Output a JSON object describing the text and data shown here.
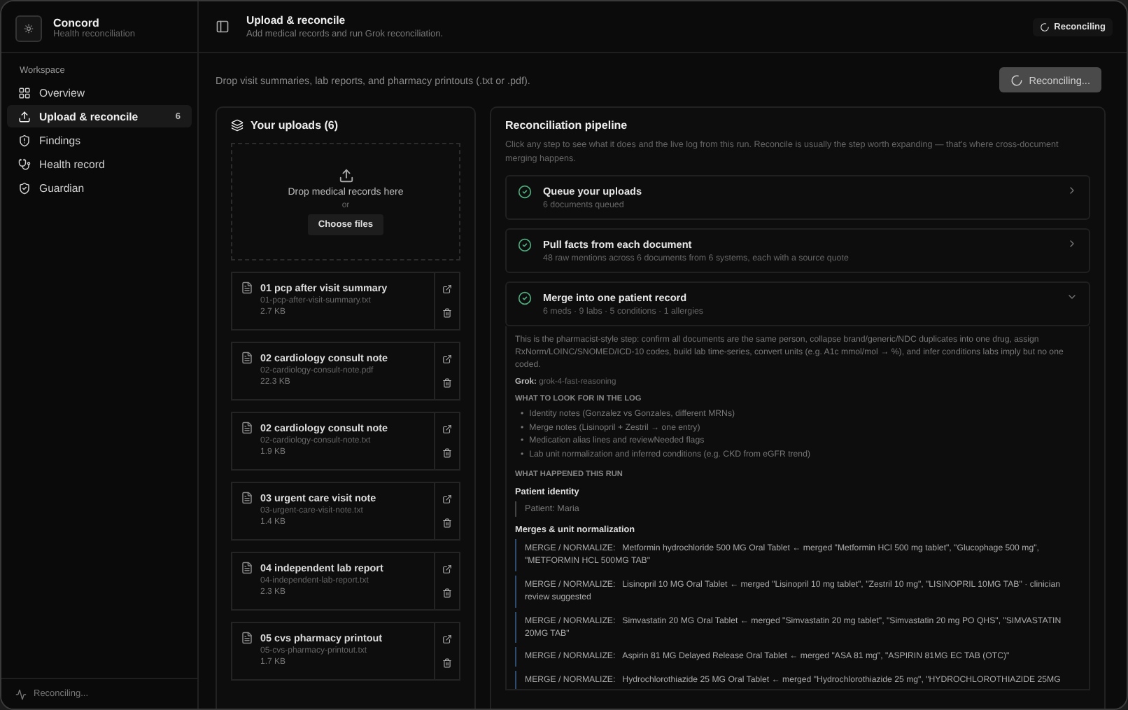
{
  "sidebar": {
    "app_name": "Concord",
    "app_subtitle": "Health reconciliation",
    "section": "Workspace",
    "items": [
      {
        "kind": "overview",
        "label": "Overview",
        "selected": false
      },
      {
        "kind": "upload",
        "label": "Upload & reconcile",
        "selected": true,
        "count": "6"
      },
      {
        "kind": "findings",
        "label": "Findings",
        "selected": false
      },
      {
        "kind": "health",
        "label": "Health record",
        "selected": false
      },
      {
        "kind": "guardian",
        "label": "Guardian",
        "selected": false
      }
    ],
    "footer_status": "Reconciling..."
  },
  "header": {
    "title": "Upload & reconcile",
    "subtitle": "Add medical records and run Grok reconciliation.",
    "status_badge": "Reconciling"
  },
  "intro": "Drop visit summaries, lab reports, and pharmacy printouts (.txt or .pdf).",
  "action_button": {
    "label": "Reconciling...",
    "disabled": true
  },
  "uploads": {
    "title": "Your uploads (6)",
    "dropzone": {
      "text": "Drop medical records here",
      "or": "or",
      "button": "Choose files"
    },
    "files": [
      {
        "name": "01 pcp after visit summary",
        "filename": "01-pcp-after-visit-summary.txt",
        "size": "2.7 KB"
      },
      {
        "name": "02 cardiology consult note",
        "filename": "02-cardiology-consult-note.pdf",
        "size": "22.3 KB"
      },
      {
        "name": "02 cardiology consult note",
        "filename": "02-cardiology-consult-note.txt",
        "size": "1.9 KB"
      },
      {
        "name": "03 urgent care visit note",
        "filename": "03-urgent-care-visit-note.txt",
        "size": "1.4 KB"
      },
      {
        "name": "04 independent lab report",
        "filename": "04-independent-lab-report.txt",
        "size": "2.3 KB"
      },
      {
        "name": "05 cvs pharmacy printout",
        "filename": "05-cvs-pharmacy-printout.txt",
        "size": "1.7 KB"
      }
    ]
  },
  "pipeline": {
    "title": "Reconciliation pipeline",
    "description": "Click any step to see what it does and the live log from this run. Reconcile is usually the step worth expanding — that's where cross-document merging happens.",
    "steps": [
      {
        "title": "Queue your uploads",
        "subtitle": "6 documents queued",
        "done": true,
        "expanded": false
      },
      {
        "title": "Pull facts from each document",
        "subtitle": "48 raw mentions across 6 documents from 6 systems, each with a source quote",
        "done": true,
        "expanded": false
      },
      {
        "title": "Merge into one patient record",
        "subtitle": "6 meds · 9 labs · 5 conditions · 1 allergies",
        "done": true,
        "expanded": true
      }
    ],
    "detail": {
      "description": "This is the pharmacist-style step: confirm all documents are the same person, collapse brand/generic/NDC duplicates into one drug, assign RxNorm/LOINC/SNOMED/ICD-10 codes, build lab time-series, convert units (e.g. A1c mmol/mol → %), and infer conditions labs imply but no one coded.",
      "model": "**Grok:** grok-4-fast-reasoning",
      "look_for_heading": "WHAT TO LOOK FOR IN THE LOG",
      "look_for": [
        {
          "marker": "•",
          "text": "Identity notes (Gonzalez vs Gonzales, different MRNs)"
        },
        {
          "marker": "•",
          "text": "Merge notes (Lisinopril + Zestril → one entry)"
        },
        {
          "marker": "•",
          "text": "Medication alias lines and reviewNeeded flags"
        },
        {
          "marker": "•",
          "text": "Lab unit normalization and inferred conditions (e.g. CKD from eGFR trend)"
        }
      ],
      "happened_heading": "WHAT HAPPENED THIS RUN",
      "identity_heading": "Patient identity",
      "identity": "Patient: Maria",
      "merges_heading": "Merges & unit normalization",
      "merges": [
        {
          "label": "MERGE / NORMALIZE:",
          "text": "Metformin hydrochloride 500 MG Oral Tablet ← merged \"Metformin HCl 500 mg tablet\", \"Glucophage 500 mg\", \"METFORMIN HCL 500MG TAB\""
        },
        {
          "label": "MERGE / NORMALIZE:",
          "text": "Lisinopril 10 MG Oral Tablet ← merged \"Lisinopril 10 mg tablet\", \"Zestril 10 mg\", \"LISINOPRIL 10MG TAB\" · clinician review suggested"
        },
        {
          "label": "MERGE / NORMALIZE:",
          "text": "Simvastatin 20 MG Oral Tablet ← merged \"Simvastatin 20 mg tablet\", \"Simvastatin 20 mg PO QHS\", \"SIMVASTATIN 20MG TAB\""
        },
        {
          "label": "MERGE / NORMALIZE:",
          "text": "Aspirin 81 MG Delayed Release Oral Tablet ← merged \"ASA 81 mg\", \"ASPIRIN 81MG EC TAB (OTC)\""
        },
        {
          "label": "MERGE / NORMALIZE:",
          "text": "Hydrochlorothiazide 25 MG Oral Tablet ← merged \"Hydrochlorothiazide 25 mg\", \"HYDROCHLOROTHIAZIDE 25MG"
        }
      ]
    }
  }
}
